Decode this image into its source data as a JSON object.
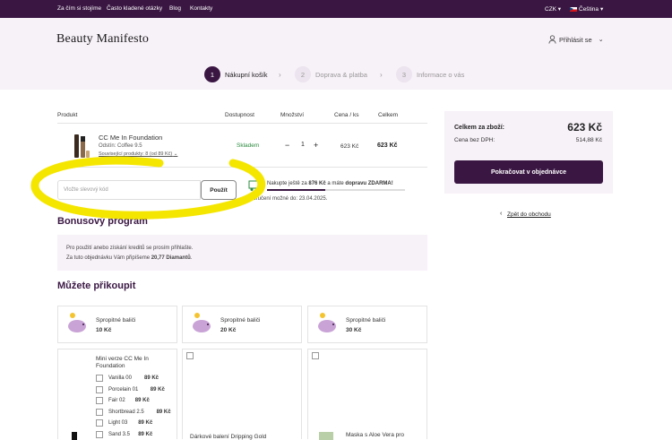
{
  "topbar": {
    "links": [
      "Za čím si stojíme",
      "Často kladené otázky",
      "Blog",
      "Kontakty"
    ],
    "currency": "CZK",
    "language": "Čeština"
  },
  "header": {
    "logo": "Beauty Manifesto",
    "login": "Přihlásit se"
  },
  "steps": [
    {
      "num": "1",
      "label": "Nákupní košík",
      "active": true
    },
    {
      "num": "2",
      "label": "Doprava & platba",
      "active": false
    },
    {
      "num": "3",
      "label": "Informace o vás",
      "active": false
    }
  ],
  "table": {
    "headers": {
      "product": "Produkt",
      "availability": "Dostupnost",
      "quantity": "Množství",
      "unit_price": "Cena / ks",
      "total": "Celkem"
    },
    "item": {
      "name": "CC Me In Foundation",
      "shade": "Odstín: Coffee 9.5",
      "related": "Související produkty: 8 (od 89 Kč)",
      "stock": "Skladem",
      "qty": "1",
      "minus": "−",
      "plus": "+",
      "unit_price": "623 Kč",
      "total": "623 Kč"
    }
  },
  "voucher": {
    "placeholder": "Vložte slevový kód",
    "button": "Použít"
  },
  "shipping": {
    "pre": "Nakupte ještě za ",
    "amount": "876 Kč",
    "mid": " a máte ",
    "free": "dopravu ZDARMA!",
    "progress": 0.42,
    "delivery": "Doručení možné do: 23.04.2025."
  },
  "bonus": {
    "title": "Bonusový program",
    "line1": "Pro použití anebo získání kreditů se prosím přihlašte.",
    "line2_pre": "Za tuto objednávku Vám připíšeme ",
    "line2_bold": "20,77 Diamantů",
    "line2_post": "."
  },
  "addons": {
    "title": "Můžete přikoupit",
    "tips": [
      {
        "label": "Spropitné baliči",
        "price": "10 Kč"
      },
      {
        "label": "Spropitné baliči",
        "price": "20 Kč"
      },
      {
        "label": "Spropitné baliči",
        "price": "30 Kč"
      }
    ],
    "mini": {
      "title": "Mini verze CC Me In Foundation",
      "options": [
        {
          "name": "Vanilla 00",
          "price": "89 Kč"
        },
        {
          "name": "Porcelain 01",
          "price": "89 Kč"
        },
        {
          "name": "Fair 02",
          "price": "89 Kč"
        },
        {
          "name": "Shortbread 2.5",
          "price": "89 Kč"
        },
        {
          "name": "Light 03",
          "price": "89 Kč"
        },
        {
          "name": "Sand 3.5",
          "price": "89 Kč"
        }
      ]
    },
    "gift": {
      "title": "Dárkové balení Dripping Gold"
    },
    "mask": {
      "title": "Maska s Aloe Vera pro"
    }
  },
  "summary": {
    "total_label": "Celkem za zboží:",
    "total": "623 Kč",
    "novat_label": "Cena bez DPH:",
    "novat": "514,88 Kč",
    "cta": "Pokračovat v objednávce",
    "back": "Zpět do obchodu"
  },
  "colors": {
    "brand": "#3a1743",
    "stock": "#2b8a3e",
    "highlight": "#f5e600"
  }
}
